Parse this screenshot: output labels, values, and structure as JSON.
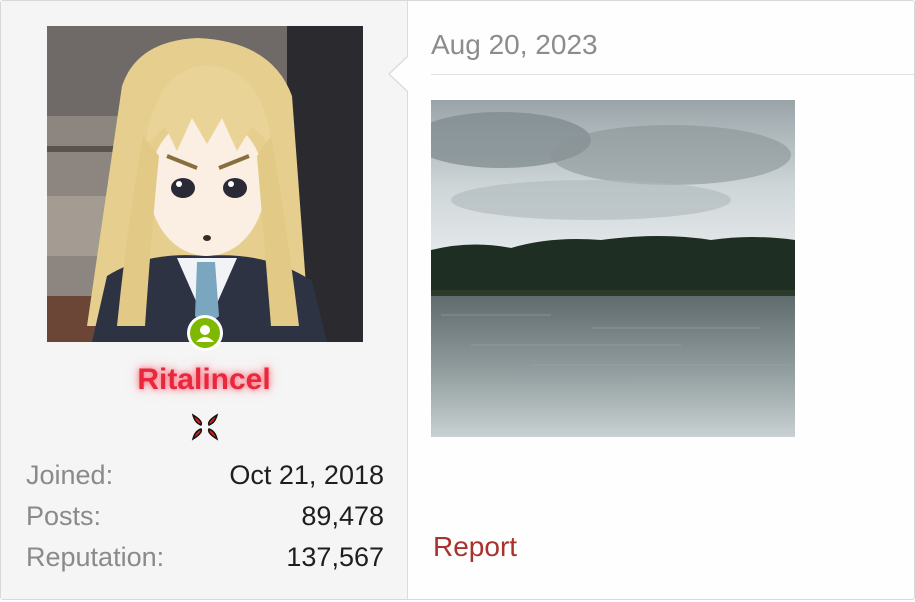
{
  "post": {
    "date": "Aug 20, 2023",
    "report_label": "Report"
  },
  "user": {
    "name": "Ritalincel",
    "online": true,
    "avatar_icon": "anime-girl-avatar",
    "rank_icon": "anger-symbol-icon",
    "stats": [
      {
        "label": "Joined:",
        "value": "Oct 21, 2018"
      },
      {
        "label": "Posts:",
        "value": "89,478"
      },
      {
        "label": "Reputation:",
        "value": "137,567"
      }
    ]
  },
  "colors": {
    "username": "#e8283c",
    "online_badge": "#7fb800",
    "report_link": "#a8322d"
  }
}
